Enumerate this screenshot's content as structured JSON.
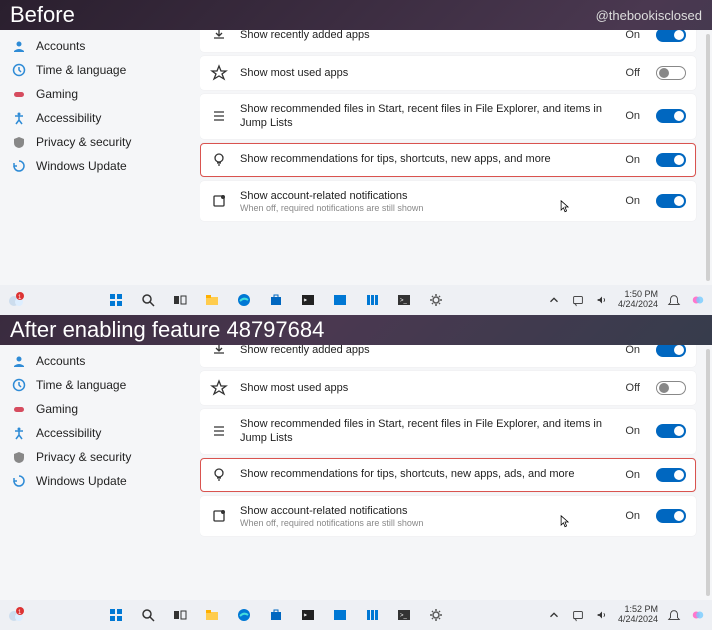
{
  "credit": "@thebookisclosed",
  "before": {
    "caption": "Before",
    "sidebar": [
      {
        "label": "Accounts",
        "icon": "accounts"
      },
      {
        "label": "Time & language",
        "icon": "time"
      },
      {
        "label": "Gaming",
        "icon": "gaming"
      },
      {
        "label": "Accessibility",
        "icon": "accessibility"
      },
      {
        "label": "Privacy & security",
        "icon": "privacy"
      },
      {
        "label": "Windows Update",
        "icon": "update"
      }
    ],
    "rows": [
      {
        "icon": "download",
        "title": "Show recently added apps",
        "state": "On",
        "on": true,
        "hl": false
      },
      {
        "icon": "star",
        "title": "Show most used apps",
        "state": "Off",
        "on": false,
        "hl": false
      },
      {
        "icon": "list",
        "title": "Show recommended files in Start, recent files in File Explorer, and items in Jump Lists",
        "state": "On",
        "on": true,
        "hl": false
      },
      {
        "icon": "bulb",
        "title": "Show recommendations for tips, shortcuts, new apps, and more",
        "state": "On",
        "on": true,
        "hl": true
      },
      {
        "icon": "notif",
        "title": "Show account-related notifications",
        "sub": "When off, required notifications are still shown",
        "state": "On",
        "on": true,
        "hl": false
      }
    ],
    "time": "1:50 PM",
    "date": "4/24/2024"
  },
  "after": {
    "caption": "After enabling feature 48797684",
    "sidebar": [
      {
        "label": "Accounts",
        "icon": "accounts"
      },
      {
        "label": "Time & language",
        "icon": "time"
      },
      {
        "label": "Gaming",
        "icon": "gaming"
      },
      {
        "label": "Accessibility",
        "icon": "accessibility"
      },
      {
        "label": "Privacy & security",
        "icon": "privacy"
      },
      {
        "label": "Windows Update",
        "icon": "update"
      }
    ],
    "rows": [
      {
        "icon": "download",
        "title": "Show recently added apps",
        "state": "On",
        "on": true,
        "hl": false
      },
      {
        "icon": "star",
        "title": "Show most used apps",
        "state": "Off",
        "on": false,
        "hl": false
      },
      {
        "icon": "list",
        "title": "Show recommended files in Start, recent files in File Explorer, and items in Jump Lists",
        "state": "On",
        "on": true,
        "hl": false
      },
      {
        "icon": "bulb",
        "title": "Show recommendations for tips, shortcuts, new apps, ads, and more",
        "state": "On",
        "on": true,
        "hl": true
      },
      {
        "icon": "notif",
        "title": "Show account-related notifications",
        "sub": "When off, required notifications are still shown",
        "state": "On",
        "on": true,
        "hl": false
      }
    ],
    "time": "1:52 PM",
    "date": "4/24/2024"
  },
  "taskbar_icons": [
    "start",
    "search",
    "taskview",
    "explorer",
    "edge",
    "store",
    "terminal",
    "bluetooth",
    "tasks",
    "cmd",
    "settings"
  ],
  "tray_icons": [
    "chevron",
    "cast",
    "sound"
  ]
}
